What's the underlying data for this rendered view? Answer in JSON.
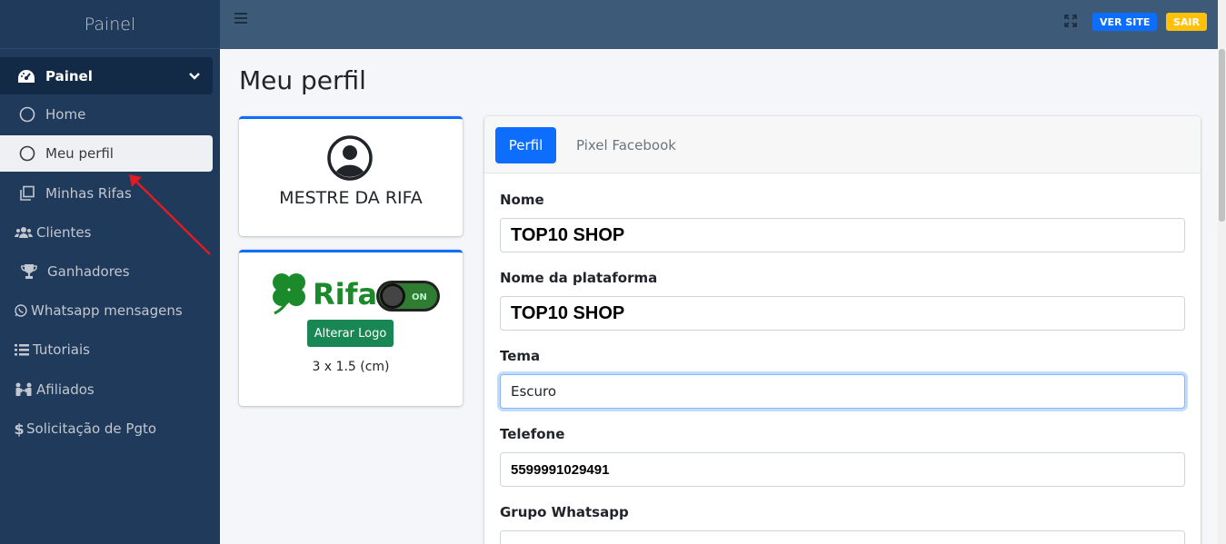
{
  "sidebar": {
    "brand": "Painel",
    "group": {
      "label": "Painel",
      "icon": "gauge-icon",
      "chevron": "chevron-down-icon"
    },
    "subitems": [
      {
        "label": "Home",
        "icon": "circle-icon",
        "active": false
      },
      {
        "label": "Meu perfil",
        "icon": "circle-icon",
        "active": true
      },
      {
        "label": "Minhas Rifas",
        "icon": "copy-icon",
        "active": false
      }
    ],
    "items": [
      {
        "label": "Clientes",
        "icon": "users-icon"
      },
      {
        "label": "Ganhadores",
        "icon": "trophy-icon"
      },
      {
        "label": "Whatsapp mensagens",
        "icon": "whatsapp-icon"
      },
      {
        "label": "Tutoriais",
        "icon": "list-icon"
      },
      {
        "label": "Afiliados",
        "icon": "people-arrows-icon"
      },
      {
        "label": "Solicitação de Pgto",
        "icon": "dollar-icon"
      }
    ]
  },
  "topbar": {
    "ver_site": "VER SITE",
    "sair": "SAIR"
  },
  "page": {
    "title": "Meu perfil"
  },
  "profile_card": {
    "name": "MESTRE DA RIFA"
  },
  "logo_card": {
    "logo_text": "Rifa",
    "toggle_text": "ON",
    "button": "Alterar Logo",
    "size": "3 x 1.5 (cm)"
  },
  "form": {
    "tabs": [
      "Perfil",
      "Pixel Facebook"
    ],
    "fields": [
      {
        "label": "Nome",
        "value": "TOP10 SHOP"
      },
      {
        "label": "Nome da plataforma",
        "value": "TOP10 SHOP"
      },
      {
        "label": "Tema",
        "value": "Escuro"
      },
      {
        "label": "Telefone",
        "value": "5599991029491"
      },
      {
        "label": "Grupo Whatsapp",
        "value": ""
      }
    ]
  },
  "colors": {
    "sidebar": "#1f3a5a",
    "topbar": "#3e5a79",
    "primary": "#0d6efd",
    "success": "#198754",
    "warning": "#ffc107"
  }
}
